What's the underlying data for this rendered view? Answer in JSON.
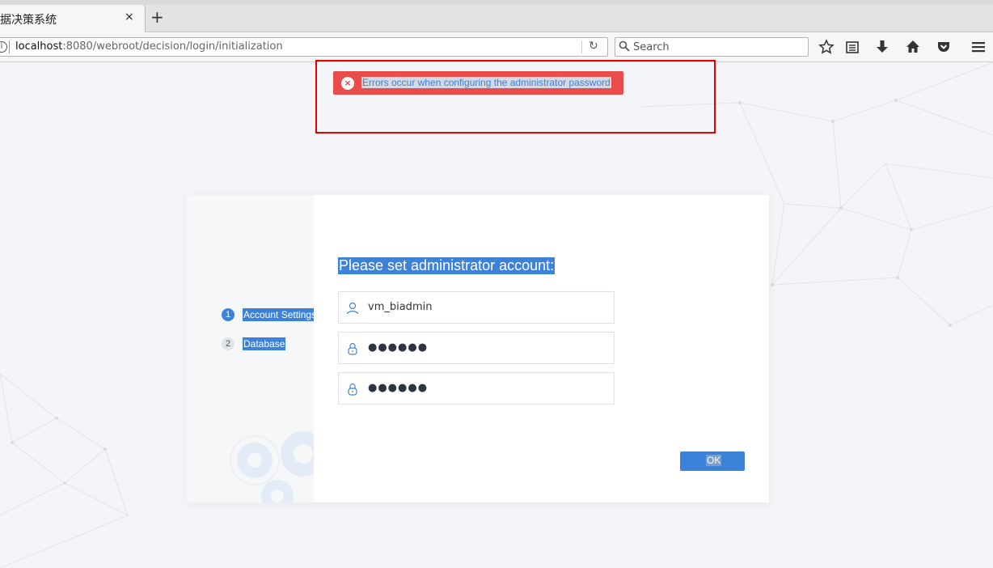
{
  "browser": {
    "tab_title": "据决策系统",
    "tab_close_icon": "×",
    "new_tab_icon": "+",
    "url_host": "localhost",
    "url_path": ":8080/webroot/decision/login/initialization",
    "search_placeholder": "Search",
    "toolbar_icons": [
      "bookmark-star-icon",
      "reading-list-icon",
      "download-icon",
      "home-icon",
      "pocket-icon",
      "menu-icon"
    ]
  },
  "toast": {
    "message": "Errors occur when configuring the administrator password",
    "icon": "×",
    "color": "#e84c4c"
  },
  "dialog": {
    "steps": [
      {
        "number": "1",
        "label": "Account Settings",
        "active": true
      },
      {
        "number": "2",
        "label": "Database",
        "active": false
      }
    ],
    "heading": "Please set administrator account:",
    "username": "vm_biadmin",
    "password_mask": "●●●●●●",
    "confirm_password_mask": "●●●●●●",
    "ok_label": "OK",
    "accent_color": "#3d82d9"
  }
}
